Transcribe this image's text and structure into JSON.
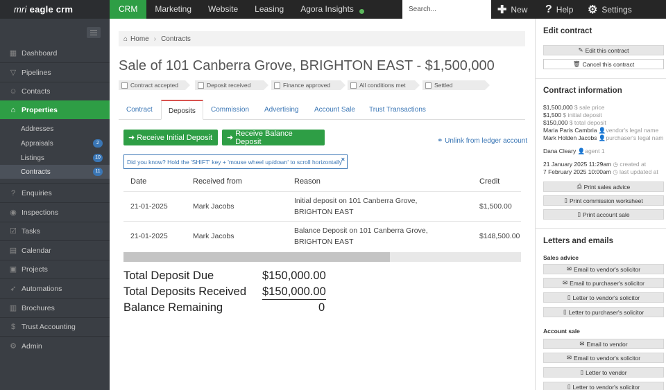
{
  "topbar": {
    "brand_prefix": "mri",
    "brand_name": "eagle crm",
    "nav": [
      "CRM",
      "Marketing",
      "Website",
      "Leasing",
      "Agora Insights"
    ],
    "search_placeholder": "Search...",
    "new_label": "New",
    "help_label": "Help",
    "settings_label": "Settings"
  },
  "sidebar": {
    "items": [
      "Dashboard",
      "Pipelines",
      "Contacts",
      "Properties"
    ],
    "subitems": [
      {
        "label": "Addresses",
        "badge": ""
      },
      {
        "label": "Appraisals",
        "badge": "2"
      },
      {
        "label": "Listings",
        "badge": "10"
      },
      {
        "label": "Contracts",
        "badge": "11"
      }
    ],
    "items2": [
      "Enquiries",
      "Inspections",
      "Tasks",
      "Calendar",
      "Projects",
      "Automations",
      "Brochures",
      "Trust Accounting",
      "Admin"
    ]
  },
  "breadcrumb": {
    "home": "Home",
    "current": "Contracts"
  },
  "page_title": "Sale of 101 Canberra Grove, BRIGHTON EAST - $1,500,000",
  "statuses": [
    "Contract accepted",
    "Deposit received",
    "Finance approved",
    "All conditions met",
    "Settled"
  ],
  "tabs": [
    "Contract",
    "Deposits",
    "Commission",
    "Advertising",
    "Account Sale",
    "Trust Transactions"
  ],
  "actions": {
    "receive_initial": "Receive Initial Deposit",
    "receive_balance": "Receive Balance Deposit",
    "unlink": "Unlink from ledger account"
  },
  "tip": "Did you know? Hold the 'SHIFT' key + 'mouse wheel up/down' to scroll horizontally",
  "table": {
    "headers": [
      "Date",
      "Received from",
      "Reason",
      "Credit"
    ],
    "rows": [
      {
        "date": "21-01-2025",
        "from": "Mark Jacobs",
        "reason1": "Initial deposit on 101 Canberra Grove,",
        "reason2": "BRIGHTON EAST",
        "credit": "$1,500.00"
      },
      {
        "date": "21-01-2025",
        "from": "Mark Jacobs",
        "reason1": "Balance Deposit on 101 Canberra Grove,",
        "reason2": "BRIGHTON EAST",
        "credit": "$148,500.00"
      }
    ],
    "scroll_fraction": 0.67
  },
  "totals": {
    "due_label": "Total Deposit Due",
    "due_value": "$150,000.00",
    "received_label": "Total Deposits Received",
    "received_value": "$150,000.00",
    "balance_label": "Balance Remaining",
    "balance_value": "0"
  },
  "right_panel": {
    "edit_title": "Edit contract",
    "edit_btn": "Edit this contract",
    "cancel_btn": "Cancel this contract",
    "info_title": "Contract information",
    "info": {
      "sale_price": "$1,500,000",
      "sale_price_lbl": "$ sale price",
      "initial_deposit": "$1,500",
      "initial_deposit_lbl": "$ initial deposit",
      "total_deposit": "$150,000",
      "total_deposit_lbl": "$ total deposit",
      "vendor": "Maria Paris Cambria",
      "vendor_lbl": "vendor's legal name",
      "purchaser": "Mark Holden Jacobs",
      "purchaser_lbl": "purchaser's legal nam",
      "agent": "Dana Cleary",
      "agent_lbl": "agent 1",
      "created": "21 January 2025 11:29am",
      "created_lbl": "created at",
      "updated": "7 February 2025 10:00am",
      "updated_lbl": "last updated at"
    },
    "print_sales_advice": "Print sales advice",
    "print_commission": "Print commission worksheet",
    "print_account_sale": "Print account sale",
    "letters_title": "Letters and emails",
    "sales_advice_label": "Sales advice",
    "sa_buttons": [
      "Email to vendor's solicitor",
      "Email to purchaser's solicitor",
      "Letter to vendor's solicitor",
      "Letter to purchaser's solicitor"
    ],
    "account_sale_label": "Account sale",
    "as_buttons": [
      "Email to vendor",
      "Email to vendor's solicitor",
      "Letter to vendor",
      "Letter to vendor's solicitor"
    ]
  },
  "colors": {
    "accent_green": "#2e9e45",
    "sidebar": "#3a3e44",
    "topbar": "#262626",
    "link_blue": "#3a76b5"
  }
}
